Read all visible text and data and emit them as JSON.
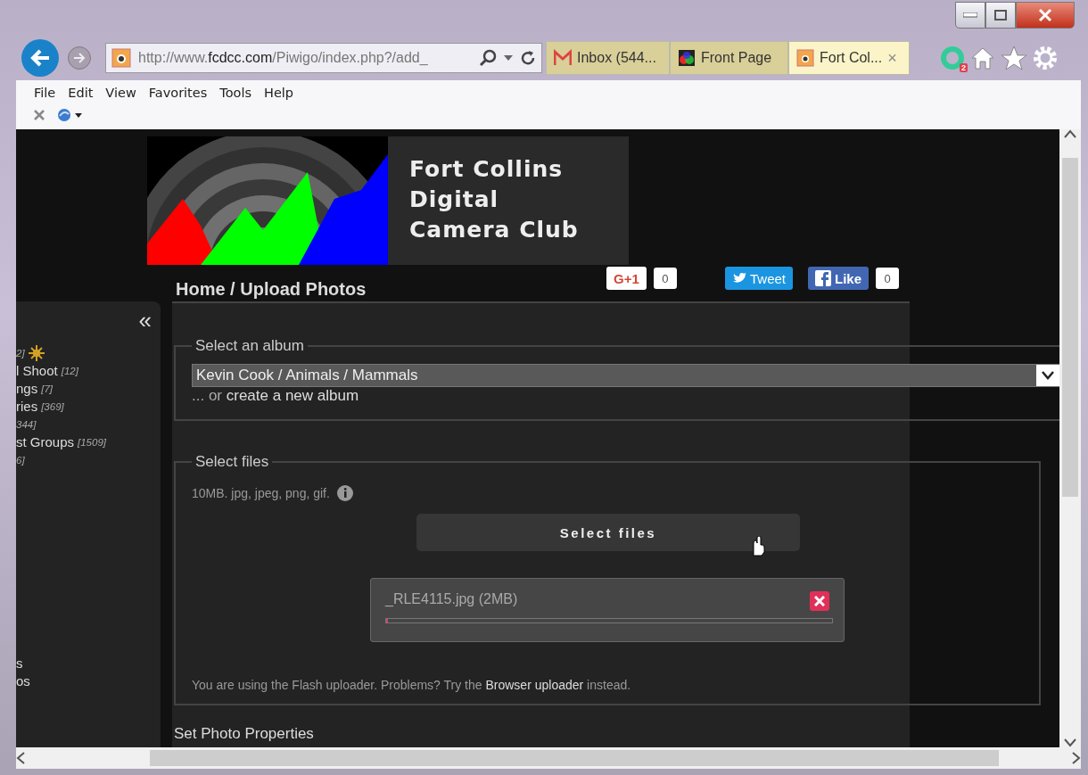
{
  "browser": {
    "address": {
      "scheme": "http://www.",
      "host": "fcdcc.com",
      "path": "/Piwigo/index.php?/add_"
    },
    "tabs": [
      {
        "title": "Inbox (544...",
        "kind": "mail",
        "selected": false
      },
      {
        "title": "Front Page",
        "kind": "photo",
        "selected": false
      },
      {
        "title": "Fort Col...",
        "kind": "camera",
        "selected": true,
        "close": "×"
      }
    ],
    "extension_badge": "2",
    "menu": [
      "File",
      "Edit",
      "View",
      "Favorites",
      "Tools",
      "Help"
    ]
  },
  "page": {
    "logo_lines": [
      "Fort Collins",
      "Digital",
      "Camera Club"
    ],
    "social": [
      {
        "kind": "gplus",
        "label": "G+1",
        "count": "0"
      },
      {
        "kind": "tweet",
        "label": "Tweet"
      },
      {
        "kind": "like",
        "label": "Like",
        "count": "0"
      }
    ],
    "breadcrumb": "Home / Upload Photos",
    "sidebar": {
      "collapse": "«",
      "items": [
        {
          "count": "2]",
          "kind": "new"
        },
        {
          "text": "l Shoot",
          "count": "[12]",
          "kind": "plain"
        },
        {
          "text": "ngs",
          "count": "[7]",
          "kind": "plain"
        },
        {
          "text": "ries",
          "count": "[369]",
          "kind": "plain"
        },
        {
          "count": "344]",
          "kind": "plain"
        },
        {
          "text": "st Groups",
          "count": "[1509]",
          "kind": "plain"
        },
        {
          "count": "6]",
          "kind": "plain"
        }
      ],
      "lower_items": [
        "s",
        "os"
      ]
    },
    "album": {
      "legend": "Select an album",
      "value": "Kevin Cook / Animals / Mammals",
      "create_prefix": "... or ",
      "create_link": "create a new album"
    },
    "files": {
      "legend": "Select files",
      "limits": "10MB. jpg, jpeg, png, gif.",
      "button": "Select files",
      "uploads": [
        {
          "name": "_RLE4115.jpg (2MB)",
          "level": 0.004
        }
      ],
      "note_before": "You are using the Flash uploader. Problems? Try the ",
      "note_link": "Browser uploader",
      "note_after": " instead."
    },
    "next_section": "Set Photo Properties"
  }
}
